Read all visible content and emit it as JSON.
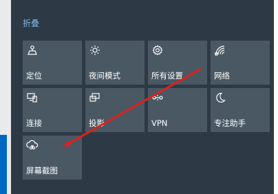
{
  "action_center": {
    "collapse_label": "折叠",
    "tiles": [
      {
        "label": "定位",
        "icon": "location-icon"
      },
      {
        "label": "夜间模式",
        "icon": "brightness-icon"
      },
      {
        "label": "所有设置",
        "icon": "gear-icon"
      },
      {
        "label": "网络",
        "icon": "network-icon"
      },
      {
        "label": "连接",
        "icon": "connect-icon"
      },
      {
        "label": "投影",
        "icon": "project-icon"
      },
      {
        "label": "VPN",
        "icon": "vpn-icon"
      },
      {
        "label": "专注助手",
        "icon": "moon-icon"
      },
      {
        "label": "屏幕截图",
        "icon": "screen-snip-icon"
      }
    ]
  },
  "annotation": {
    "color": "#e0201c"
  }
}
